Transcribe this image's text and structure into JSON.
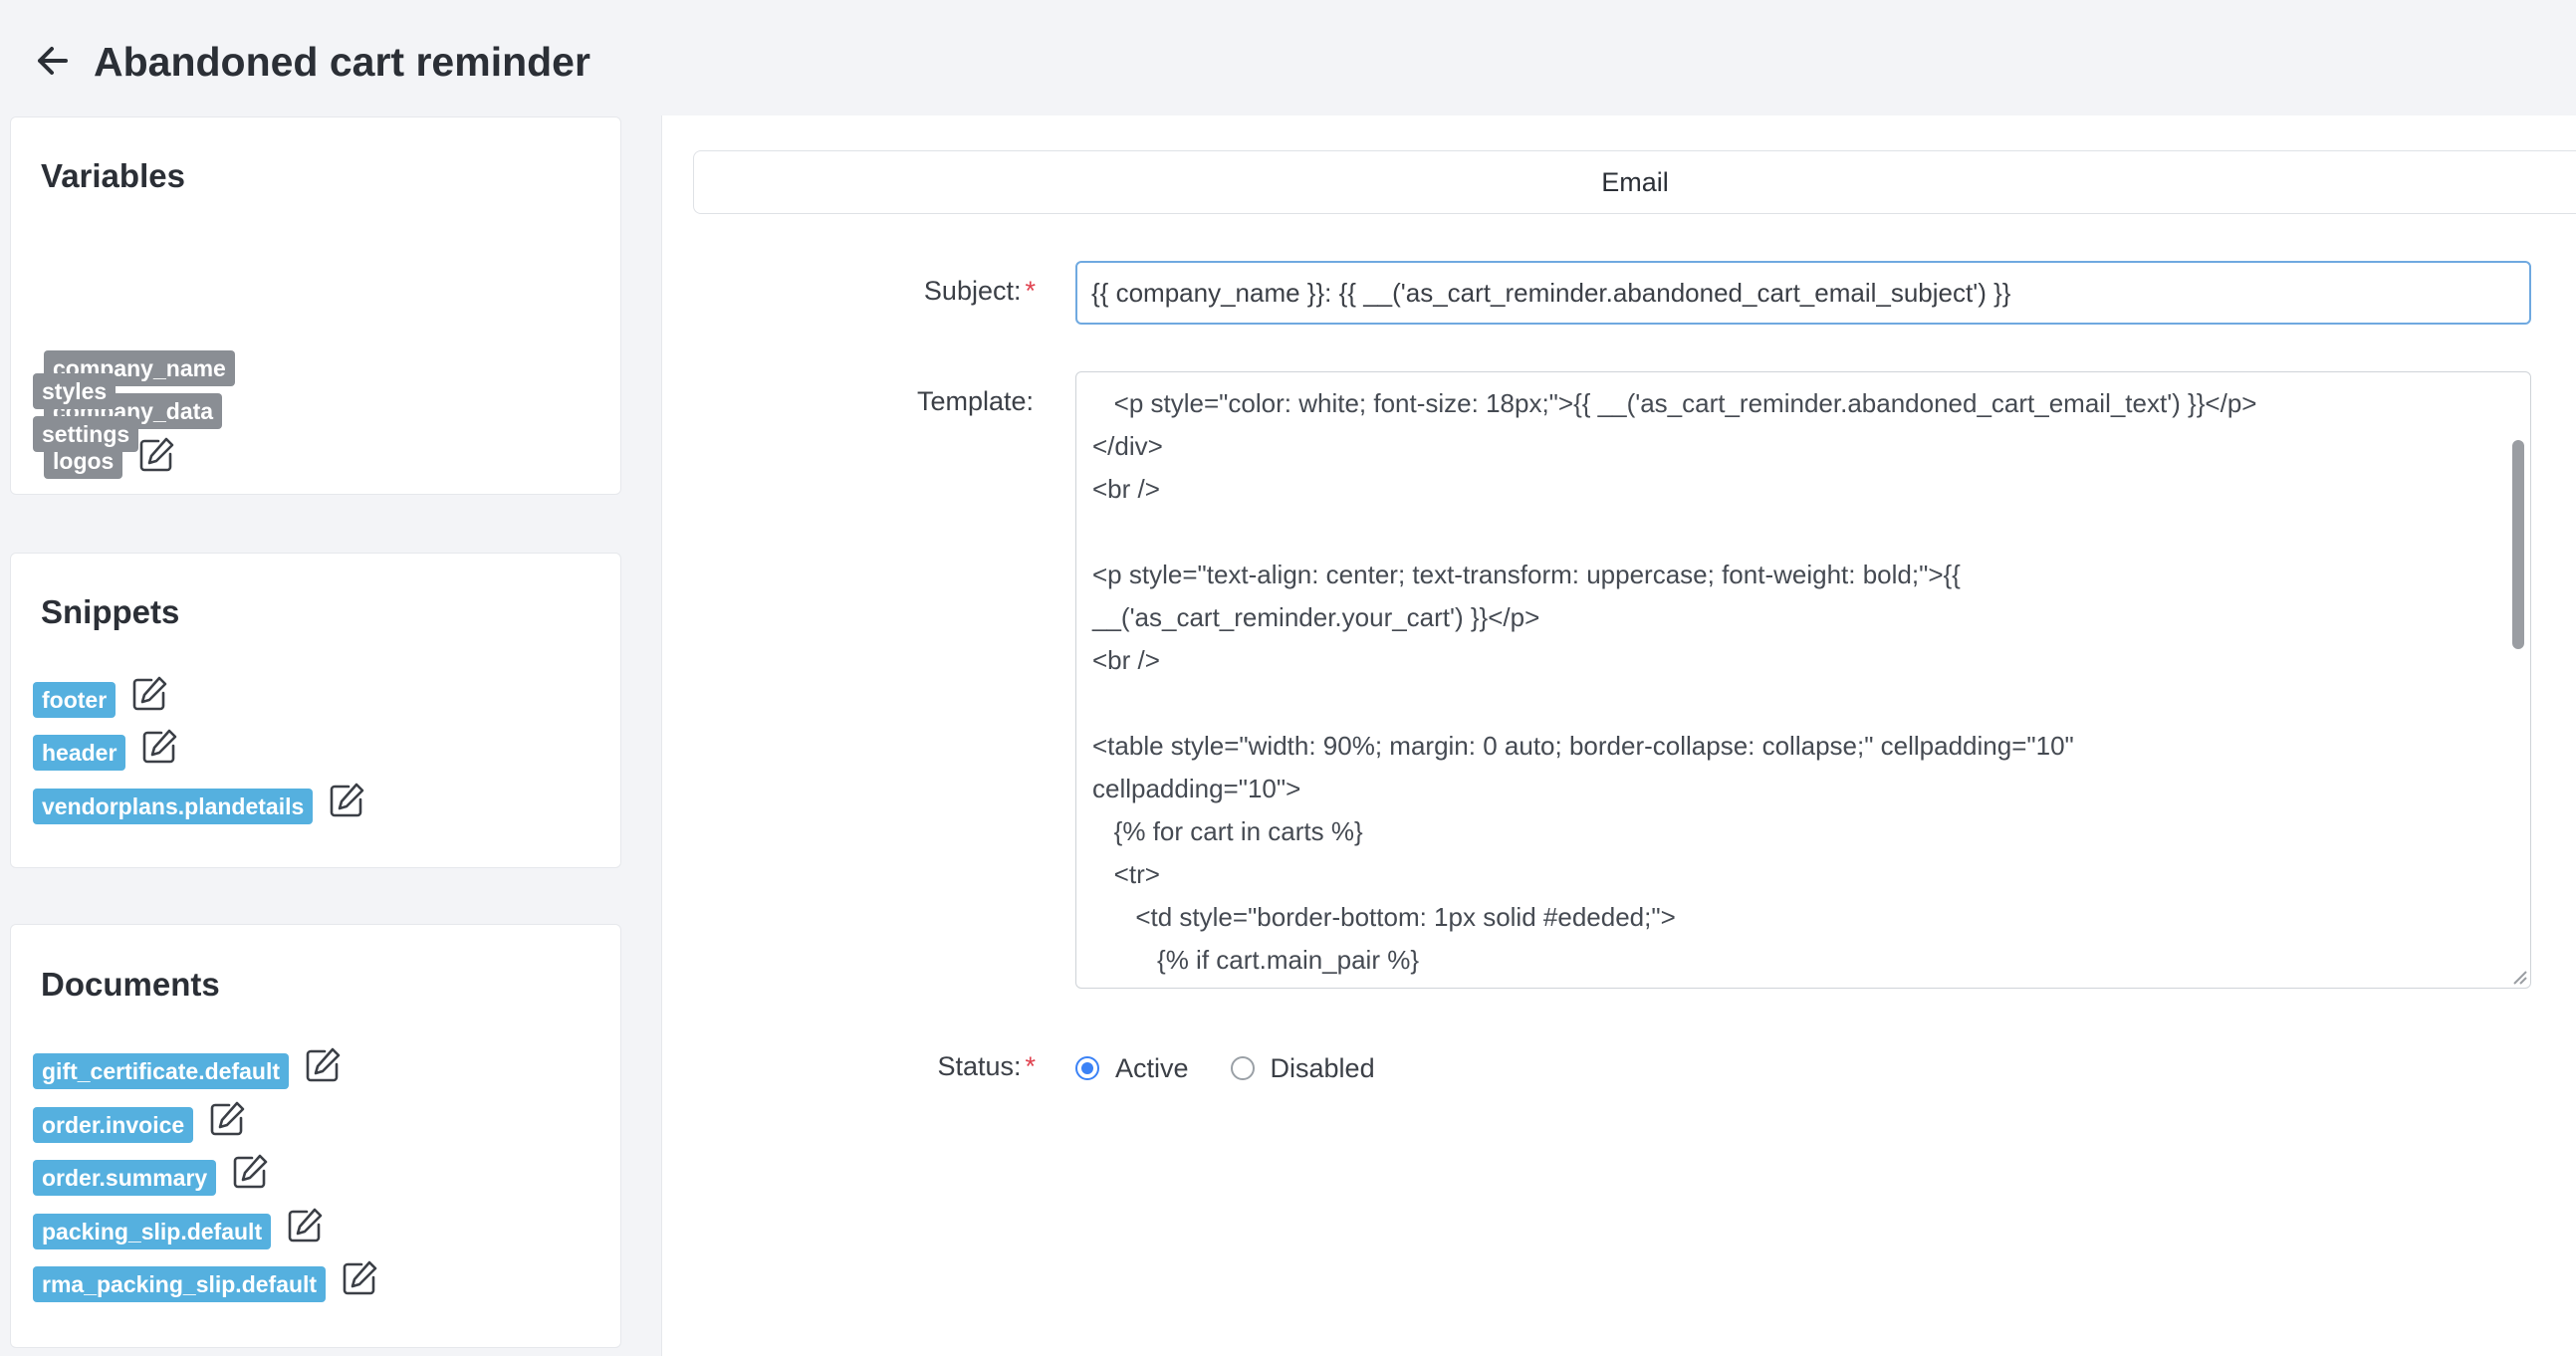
{
  "header": {
    "title": "Abandoned cart reminder"
  },
  "variables": {
    "title": "Variables",
    "items": [
      {
        "label": "company_name",
        "editable": false
      },
      {
        "label": "company_data",
        "editable": false
      },
      {
        "label": "logos",
        "editable": true
      },
      {
        "label": "styles",
        "editable": false
      },
      {
        "label": "settings",
        "editable": false
      }
    ]
  },
  "snippets": {
    "title": "Snippets",
    "items": [
      {
        "label": "footer"
      },
      {
        "label": "header"
      },
      {
        "label": "vendorplans.plandetails"
      }
    ]
  },
  "documents": {
    "title": "Documents",
    "items": [
      {
        "label": "gift_certificate.default"
      },
      {
        "label": "order.invoice"
      },
      {
        "label": "order.summary"
      },
      {
        "label": "packing_slip.default"
      },
      {
        "label": "rma_packing_slip.default"
      }
    ]
  },
  "editor": {
    "tab_label": "Email",
    "subject_label": "Subject:",
    "subject_value": "{{ company_name }}: {{ __('as_cart_reminder.abandoned_cart_email_subject') }}",
    "template_label": "Template:",
    "template_lines": [
      "   <p style=\"color: white; font-size: 18px;\">{{ __('as_cart_reminder.abandoned_cart_email_text') }}</p>",
      "</div>",
      "<br />",
      "",
      "<p style=\"text-align: center; text-transform: uppercase; font-weight: bold;\">{{",
      "__('as_cart_reminder.your_cart') }}</p>",
      "<br />",
      "",
      "<table style=\"width: 90%; margin: 0 auto; border-collapse: collapse;\" cellpadding=\"10\"",
      "cellpadding=\"10\">",
      "   {% for cart in carts %}",
      "   <tr>",
      "      <td style=\"border-bottom: 1px solid #ededed;\">",
      "         {% if cart.main_pair %}"
    ],
    "status_label": "Status:",
    "status_options": [
      {
        "label": "Active",
        "checked": true
      },
      {
        "label": "Disabled",
        "checked": false
      }
    ]
  },
  "colors": {
    "accent": "#3b82f6",
    "chip_gray": "#8a8e94",
    "chip_blue": "#55b0df",
    "required": "#e0424f"
  },
  "icons": {
    "back": "arrow-left-icon",
    "edit": "edit-icon"
  }
}
